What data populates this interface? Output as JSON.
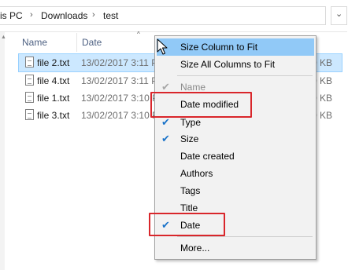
{
  "address_bar": {
    "crumbs": [
      "is PC",
      "Downloads",
      "test"
    ],
    "separator": "›",
    "dropdown": "⌄"
  },
  "columns": {
    "name": "Name",
    "date": "Date",
    "sort_indicator": "^"
  },
  "files": [
    {
      "name": "file 2.txt",
      "date": "13/02/2017 3:11 P",
      "size": "0 KB",
      "selected": true
    },
    {
      "name": "file 4.txt",
      "date": "13/02/2017 3:11 P",
      "size": "0 KB",
      "selected": false
    },
    {
      "name": "file 1.txt",
      "date": "13/02/2017 3:10 P",
      "size": "0 KB",
      "selected": false
    },
    {
      "name": "file 3.txt",
      "date": "13/02/2017 3:10 P",
      "size": "0 KB",
      "selected": false
    }
  ],
  "context_menu": {
    "items": [
      {
        "label": "Size Column to Fit",
        "checked": false,
        "highlighted": true,
        "disabled": false
      },
      {
        "label": "Size All Columns to Fit",
        "checked": false,
        "highlighted": false,
        "disabled": false
      },
      {
        "label": "Name",
        "checked": true,
        "highlighted": false,
        "disabled": true
      },
      {
        "label": "Date modified",
        "checked": false,
        "highlighted": false,
        "disabled": false
      },
      {
        "label": "Type",
        "checked": true,
        "highlighted": false,
        "disabled": false
      },
      {
        "label": "Size",
        "checked": true,
        "highlighted": false,
        "disabled": false
      },
      {
        "label": "Date created",
        "checked": false,
        "highlighted": false,
        "disabled": false
      },
      {
        "label": "Authors",
        "checked": false,
        "highlighted": false,
        "disabled": false
      },
      {
        "label": "Tags",
        "checked": false,
        "highlighted": false,
        "disabled": false
      },
      {
        "label": "Title",
        "checked": false,
        "highlighted": false,
        "disabled": false
      },
      {
        "label": "Date",
        "checked": true,
        "highlighted": false,
        "disabled": false
      },
      {
        "label": "More...",
        "checked": false,
        "highlighted": false,
        "disabled": false
      }
    ],
    "check_glyph": "✔"
  },
  "colors": {
    "selection": "#cce8ff",
    "menu_highlight": "#91c9f7",
    "annotation_red": "#d9262b",
    "check_blue": "#1a73c9"
  }
}
